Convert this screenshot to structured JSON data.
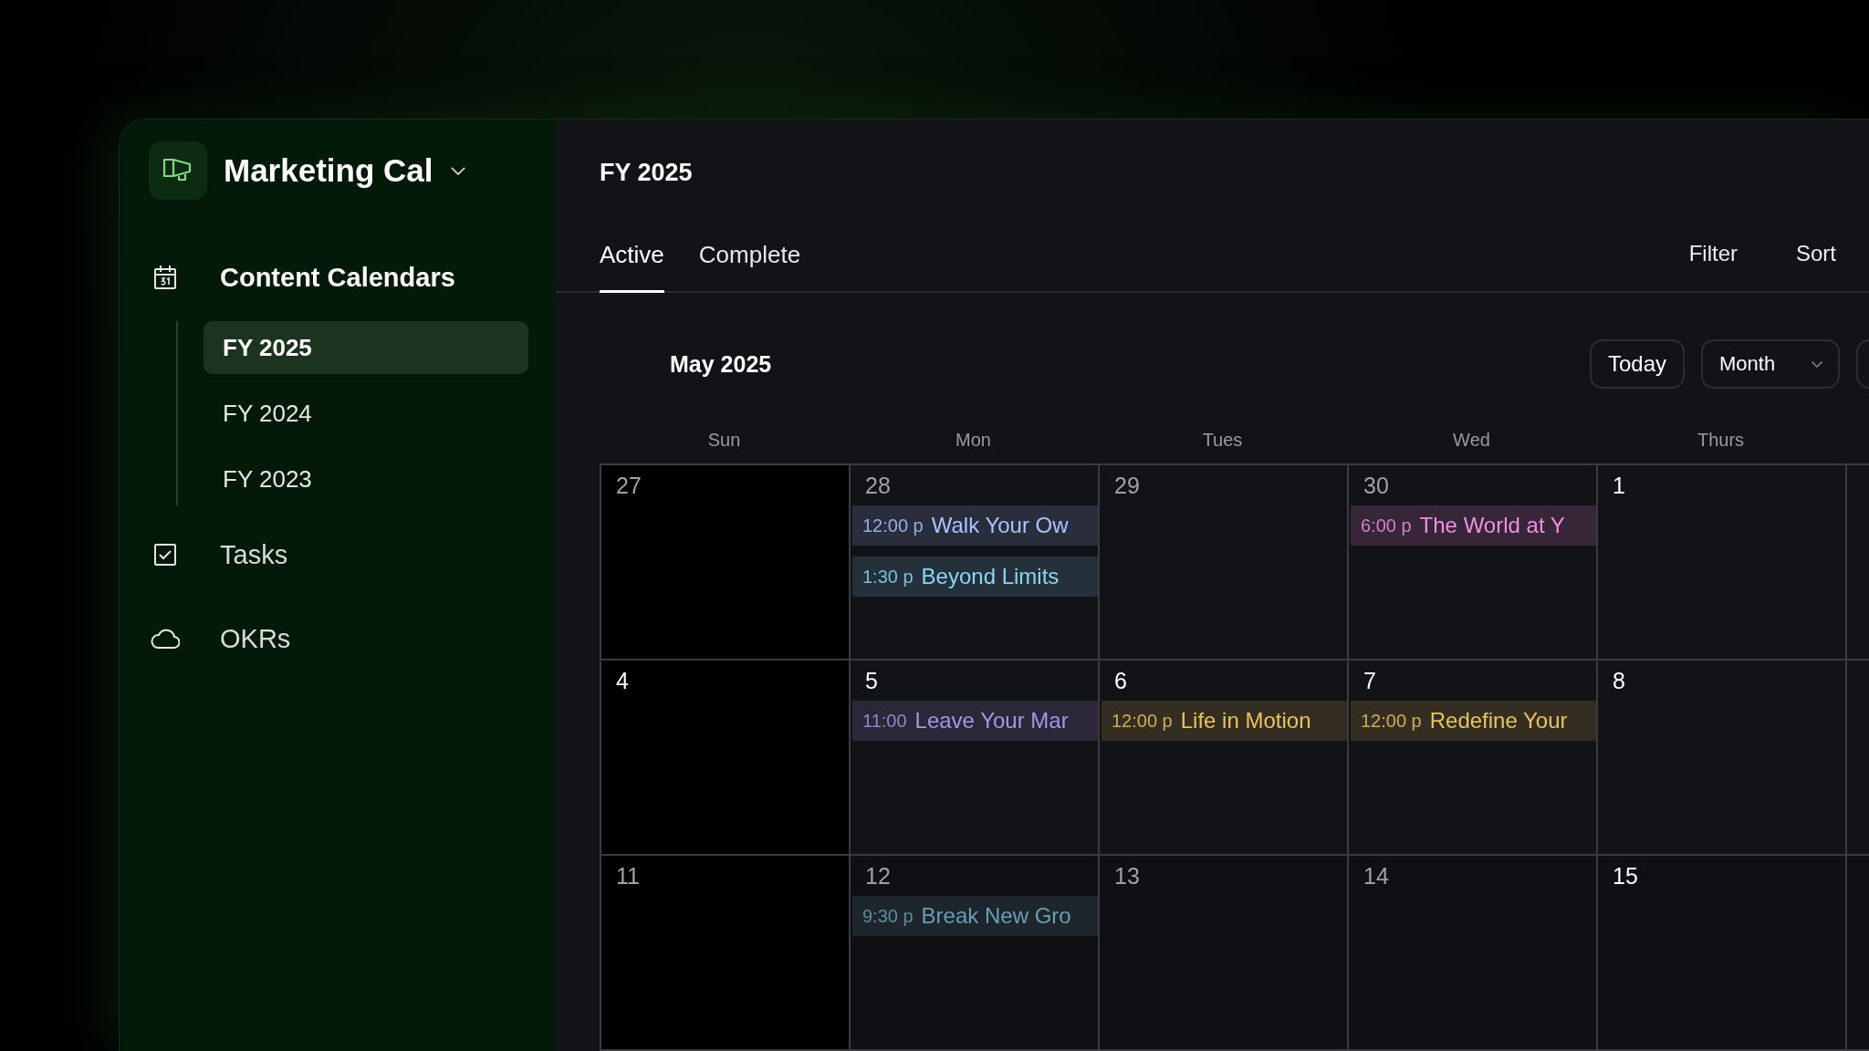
{
  "workspace": {
    "title": "Marketing Cal"
  },
  "nav": [
    {
      "label": "Content Calendars",
      "kind": "calendar",
      "selected": true,
      "children": [
        {
          "label": "FY 2025",
          "selected": true
        },
        {
          "label": "FY 2024",
          "selected": false
        },
        {
          "label": "FY 2023",
          "selected": false
        }
      ]
    },
    {
      "label": "Tasks",
      "kind": "checkbox",
      "selected": false
    },
    {
      "label": "OKRs",
      "kind": "cloud",
      "selected": false
    }
  ],
  "page": {
    "title": "FY 2025"
  },
  "tabs": [
    {
      "label": "Active",
      "selected": true
    },
    {
      "label": "Complete",
      "selected": false
    }
  ],
  "actions": [
    "Filter",
    "Sort"
  ],
  "calendar": {
    "month": "May 2025",
    "today_button": "Today",
    "view": "Month",
    "weekdays": [
      "Sun",
      "Mon",
      "Tues",
      "Wed",
      "Thurs"
    ],
    "weeks": [
      [
        {
          "date": "27",
          "muted": true
        },
        {
          "date": "28",
          "muted": true,
          "events": [
            {
              "time": "12:00 p",
              "title": "Walk Your Ow",
              "color": "#a9c3ff"
            },
            {
              "time": "1:30 p",
              "title": "Beyond Limits",
              "color": "#8ad6f5"
            }
          ]
        },
        {
          "date": "29",
          "muted": true
        },
        {
          "date": "30",
          "muted": true,
          "events": [
            {
              "time": "6:00 p",
              "title": "The World at Y",
              "color": "#f18ee3"
            }
          ]
        },
        {
          "date": "1",
          "muted": false
        }
      ],
      [
        {
          "date": "4",
          "muted": false
        },
        {
          "date": "5",
          "muted": false,
          "events": [
            {
              "time": "11:00",
              "title": "Leave Your Mar",
              "color": "#a397e6"
            }
          ]
        },
        {
          "date": "6",
          "muted": false,
          "events": [
            {
              "time": "12:00 p",
              "title": "Life in Motion",
              "color": "#e8c35c"
            }
          ]
        },
        {
          "date": "7",
          "muted": false,
          "events": [
            {
              "time": "12:00 p",
              "title": "Redefine Your",
              "color": "#e8c35c"
            }
          ]
        },
        {
          "date": "8",
          "muted": false
        }
      ],
      [
        {
          "date": "11",
          "muted": true
        },
        {
          "date": "12",
          "muted": true,
          "events": [
            {
              "time": "9:30 p",
              "title": "Break New Gro",
              "color": "#6a9db3"
            }
          ]
        },
        {
          "date": "13",
          "muted": true
        },
        {
          "date": "14",
          "muted": true
        },
        {
          "date": "15",
          "muted": false
        }
      ]
    ]
  }
}
